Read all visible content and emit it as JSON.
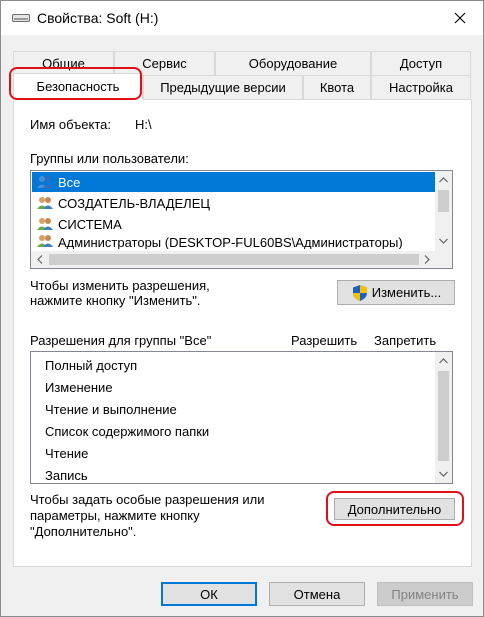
{
  "window": {
    "title": "Свойства: Soft (H:)",
    "icons": {
      "drive": "drive-icon",
      "close": "close-icon"
    }
  },
  "tabs": {
    "row1": [
      "Общие",
      "Сервис",
      "Оборудование",
      "Доступ"
    ],
    "row2": [
      "Безопасность",
      "Предыдущие версии",
      "Квота",
      "Настройка"
    ],
    "active": "Безопасность"
  },
  "security": {
    "object_label": "Имя объекта:",
    "object_value": "H:\\",
    "groups_label": "Группы или пользователи:",
    "groups": [
      {
        "name": "Все",
        "selected": true
      },
      {
        "name": "СОЗДАТЕЛЬ-ВЛАДЕЛЕЦ",
        "selected": false
      },
      {
        "name": "СИСТЕМА",
        "selected": false
      },
      {
        "name": "Администраторы (DESKTOP-FUL60BS\\Администраторы)",
        "selected": false
      }
    ],
    "change_hint": "Чтобы изменить разрешения,\nнажмите кнопку \"Изменить\".",
    "change_button": "Изменить...",
    "perms_label": "Разрешения для группы \"Все\"",
    "allow_header": "Разрешить",
    "deny_header": "Запретить",
    "permissions": [
      "Полный доступ",
      "Изменение",
      "Чтение и выполнение",
      "Список содержимого папки",
      "Чтение",
      "Запись"
    ],
    "advanced_hint": "Чтобы задать особые разрешения или\nпараметры, нажмите кнопку\n\"Дополнительно\".",
    "advanced_button": "Дополнительно"
  },
  "footer": {
    "ok": "ОК",
    "cancel": "Отмена",
    "apply": "Применить"
  },
  "colors": {
    "accent": "#0078d7",
    "highlight": "#e0101a"
  }
}
